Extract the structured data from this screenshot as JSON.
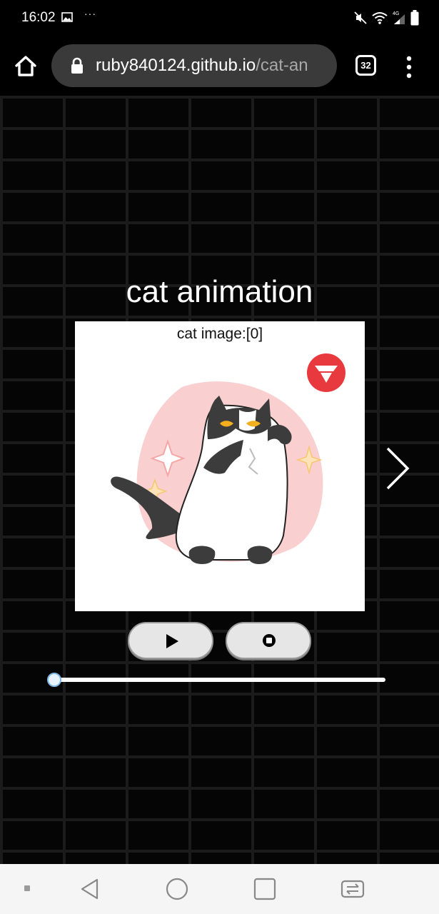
{
  "status_bar": {
    "time": "16:02",
    "dots": "···",
    "network_label": "4G",
    "icons": [
      "gallery-icon",
      "mute-icon",
      "wifi-icon",
      "signal-icon",
      "battery-icon"
    ]
  },
  "browser": {
    "url_host": "ruby840124.github.io",
    "url_path": "/cat-an",
    "tab_count": "32",
    "icons": [
      "home-icon",
      "lock-icon",
      "menu-dots-icon"
    ]
  },
  "page": {
    "title": "cat animation",
    "caption": "cat image:[0]",
    "frame_index": 0,
    "slider_progress": 0
  },
  "controls": {
    "play_icon": "play-icon",
    "stop_icon": "stop-icon"
  },
  "nav_bar": {
    "icons": [
      "back-icon",
      "home-circle-icon",
      "recents-icon",
      "swap-icon"
    ]
  },
  "colors": {
    "background": "#000000",
    "brick_line": "#1b1b1b",
    "blob": "#f9cfcf",
    "badge": "#e8393e",
    "cat_eye": "#f2b01e"
  }
}
